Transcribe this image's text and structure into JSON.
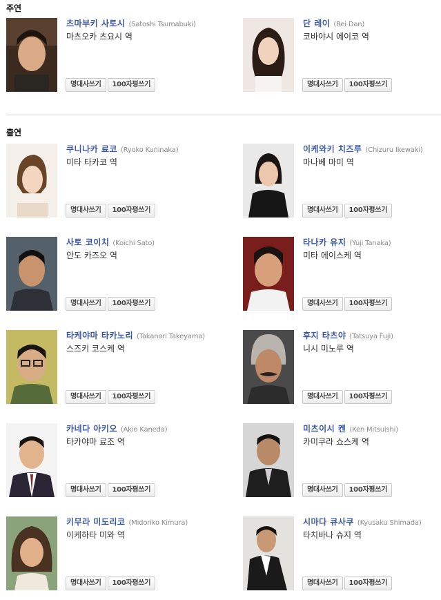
{
  "sections": {
    "lead_title": "주연",
    "support_title": "출연"
  },
  "buttons": {
    "quote": "명대사쓰기",
    "review": "100자평쓰기"
  },
  "lead": [
    {
      "kname": "츠마부키 사토시",
      "ename": "(Satoshi Tsumabuki)",
      "role": "마츠오카 츠요시 역"
    },
    {
      "kname": "단 레이",
      "ename": "(Rei Dan)",
      "role": "코바야시 에이코 역"
    }
  ],
  "support": [
    {
      "kname": "쿠니나카 료코",
      "ename": "(Ryoko Kuninaka)",
      "role": "미타 타카코 역"
    },
    {
      "kname": "이케와키 치즈루",
      "ename": "(Chizuru Ikewaki)",
      "role": "마나베 마미 역"
    },
    {
      "kname": "사토 코이치",
      "ename": "(Koichi Sato)",
      "role": "안도 카즈오 역"
    },
    {
      "kname": "타나카 유지",
      "ename": "(Yuji Tanaka)",
      "role": "미타 에이스케 역"
    },
    {
      "kname": "타케야마 타카노리",
      "ename": "(Takanori Takeyama)",
      "role": "스즈키 코스케 역"
    },
    {
      "kname": "후지 타츠야",
      "ename": "(Tatsuya Fuji)",
      "role": "니시 미노루 역"
    },
    {
      "kname": "카네다 아키오",
      "ename": "(Akio Kaneda)",
      "role": "타카야마 료조 역"
    },
    {
      "kname": "미츠이시 켄",
      "ename": "(Ken Mitsuishi)",
      "role": "카미쿠라 쇼스케 역"
    },
    {
      "kname": "키무라 미도리코",
      "ename": "(Midoriko Kimura)",
      "role": "이케하타 미와 역"
    },
    {
      "kname": "시마다 큐사쿠",
      "ename": "(Kyusaku Shimada)",
      "role": "타치바나 슈지 역"
    }
  ]
}
